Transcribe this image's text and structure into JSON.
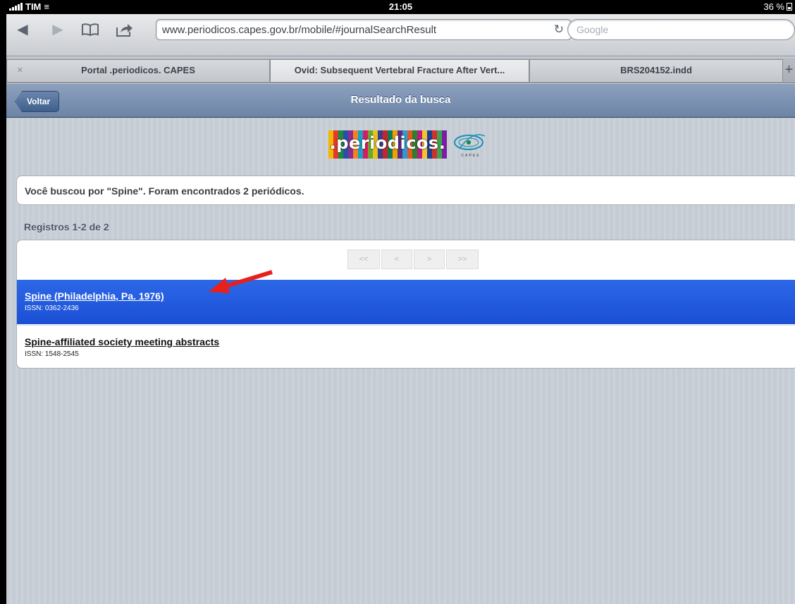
{
  "status_bar": {
    "carrier": "TIM",
    "time": "21:05",
    "battery": "36 %"
  },
  "browser": {
    "url": "www.periodicos.capes.gov.br/mobile/#journalSearchResult",
    "search_placeholder": "Google",
    "tabs": [
      {
        "label": "Portal .periodicos. CAPES"
      },
      {
        "label": "Ovid: Subsequent Vertebral Fracture After Vert..."
      },
      {
        "label": "BRS204152.indd"
      }
    ],
    "tab_close": "×",
    "tab_add": "+",
    "icons": [
      "back-icon",
      "forward-icon",
      "bookmarks-icon",
      "share-icon",
      "reload-icon"
    ]
  },
  "navbar": {
    "back_label": "Voltar",
    "title": "Resultado da busca"
  },
  "logo": {
    "text": ".periodicos.",
    "capes": "CAPES"
  },
  "search_summary": "Você buscou por \"Spine\". Foram encontrados 2 periódicos.",
  "registros": "Registros 1-2 de 2",
  "pager": [
    "<<",
    "<",
    ">",
    ">>"
  ],
  "results": [
    {
      "title": "Spine (Philadelphia, Pa. 1976)",
      "issn": "ISSN: 0362-2436",
      "selected": true
    },
    {
      "title": "Spine-affiliated society meeting abstracts",
      "issn": "ISSN: 1548-2545",
      "selected": false
    }
  ],
  "colors": {
    "selected_row": "#1f56da",
    "navbar": "#7289ab",
    "annotation_arrow": "#e8201a"
  }
}
